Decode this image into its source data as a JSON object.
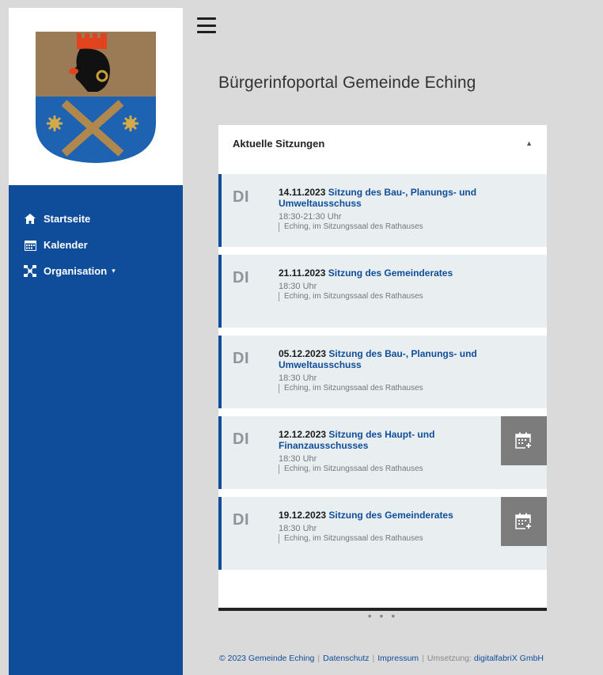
{
  "sidebar": {
    "logo_icon": "municipal-coat-of-arms",
    "items": [
      {
        "label": "Startseite",
        "icon": "home-icon"
      },
      {
        "label": "Kalender",
        "icon": "calendar-icon"
      },
      {
        "label": "Organisation",
        "icon": "organisation-icon",
        "caret": "▾"
      }
    ]
  },
  "header": {
    "menu_icon": "hamburger-menu-icon",
    "title": "Bürgerinfoportal Gemeinde Eching"
  },
  "panel": {
    "title": "Aktuelle Sitzungen",
    "collapse_symbol": "▲",
    "more_label": "• • •",
    "meetings": [
      {
        "dow": "DI",
        "date": "14.11.2023",
        "title": "Sitzung des Bau-, Planungs- und Umweltausschuss",
        "time": "18:30-21:30 Uhr",
        "place": "Eching, im Sitzungssaal des Rathauses",
        "has_calendar_button": false
      },
      {
        "dow": "DI",
        "date": "21.11.2023",
        "title": "Sitzung des Gemeinderates",
        "time": "18:30 Uhr",
        "place": "Eching, im Sitzungssaal des Rathauses",
        "has_calendar_button": false
      },
      {
        "dow": "DI",
        "date": "05.12.2023",
        "title": "Sitzung des Bau-, Planungs- und Umweltausschuss",
        "time": "18:30 Uhr",
        "place": "Eching, im Sitzungssaal des Rathauses",
        "has_calendar_button": false
      },
      {
        "dow": "DI",
        "date": "12.12.2023",
        "title": "Sitzung des Haupt- und Finanzausschusses",
        "time": "18:30 Uhr",
        "place": "Eching, im Sitzungssaal des Rathauses",
        "has_calendar_button": true
      },
      {
        "dow": "DI",
        "date": "19.12.2023",
        "title": "Sitzung des Gemeinderates",
        "time": "18:30 Uhr",
        "place": "Eching, im Sitzungssaal des Rathauses",
        "has_calendar_button": true
      }
    ]
  },
  "footer": {
    "copyright": "© 2023 Gemeinde Eching",
    "privacy": "Datenschutz",
    "imprint": "Impressum",
    "implementation_label": "Umsetzung:",
    "implementation_company": "digitalfabriX GmbH"
  },
  "colors": {
    "sidebar_bg": "#0f4d9a",
    "accent": "#0f4d9a",
    "page_bg": "#dadada",
    "meeting_bg": "#e9eff0",
    "calendar_button_bg": "#7c7c7c"
  }
}
